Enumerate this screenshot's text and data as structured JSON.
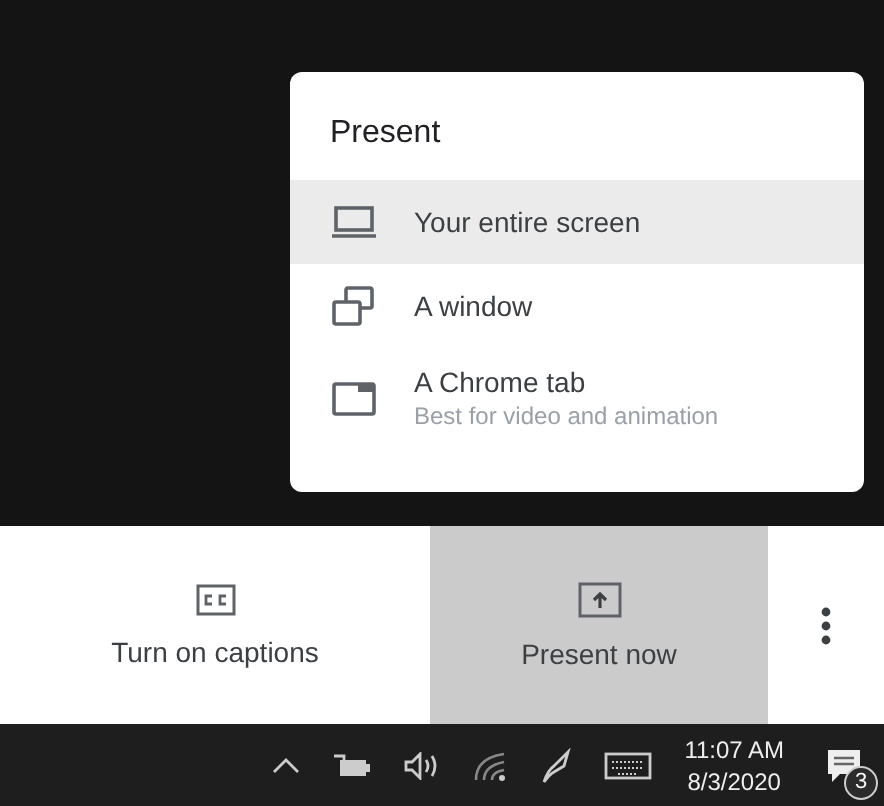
{
  "present_menu": {
    "title": "Present",
    "items": [
      {
        "kind": "screen",
        "label": "Your entire screen",
        "selected": true
      },
      {
        "kind": "window",
        "label": "A window",
        "selected": false
      },
      {
        "kind": "tab",
        "label": "A Chrome tab",
        "subtitle": "Best for video and animation",
        "selected": false
      }
    ]
  },
  "call_controls": [
    {
      "kind": "captions",
      "label": "Turn on captions",
      "active": false
    },
    {
      "kind": "present",
      "label": "Present now",
      "active": true
    },
    {
      "kind": "more"
    }
  ],
  "taskbar": {
    "time": "11:07 AM",
    "date": "8/3/2020",
    "notification_count": "3"
  }
}
